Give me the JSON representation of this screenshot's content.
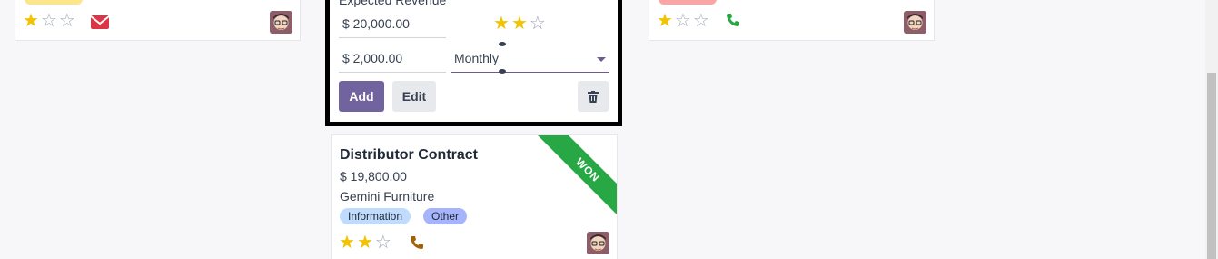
{
  "cards": {
    "left": {
      "stars_filled": 1,
      "stars_total": 3,
      "activity_icon": "envelope-icon",
      "activity_color": "#dc3545"
    },
    "right": {
      "stars_filled": 1,
      "stars_total": 3,
      "activity_icon": "phone-icon",
      "activity_color": "#28a745"
    },
    "quick_create": {
      "cut_label": "Expected Revenue",
      "expected_revenue": "$ 20,000.00",
      "recurring_revenue": "$ 2,000.00",
      "recurring_plan": "Monthly",
      "stars_filled": 2,
      "stars_total": 3,
      "add_label": "Add",
      "edit_label": "Edit",
      "delete_icon": "trash-icon"
    },
    "distributor": {
      "title": "Distributor Contract",
      "amount": "$ 19,800.00",
      "customer": "Gemini Furniture",
      "tags": [
        "Information",
        "Other"
      ],
      "ribbon": "WON",
      "stars_filled": 2,
      "stars_total": 3,
      "activity_icon": "phone-icon",
      "activity_color": "#a16207"
    }
  },
  "colors": {
    "primary": "#71639e",
    "star": "#f3c200",
    "won_ribbon": "#28a745"
  }
}
